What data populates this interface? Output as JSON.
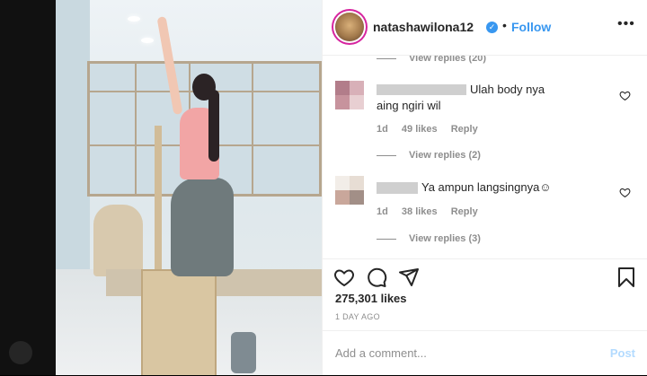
{
  "post": {
    "username": "natashawilona12",
    "separator": "•",
    "follow_label": "Follow",
    "more_label": "•••",
    "verified_mark": "✓"
  },
  "comments": {
    "view_replies_top": "View replies (20)",
    "items": [
      {
        "text_line1": "Ulah body nya",
        "text_line2": "aing ngiri wil",
        "time": "1d",
        "likes": "49 likes",
        "reply": "Reply",
        "view_replies": "View replies (2)"
      },
      {
        "text_line1": "Ya ampun langsingnya☺",
        "time": "1d",
        "likes": "38 likes",
        "reply": "Reply",
        "view_replies": "View replies (3)"
      }
    ]
  },
  "actions": {
    "likes": "275,301 likes",
    "date": "1 DAY AGO"
  },
  "add_comment": {
    "placeholder": "Add a comment...",
    "post_label": "Post"
  },
  "colors": {
    "accent": "#3897f0",
    "text": "#262626",
    "muted": "#8e8e8e",
    "post_disabled": "#b3dbff"
  }
}
